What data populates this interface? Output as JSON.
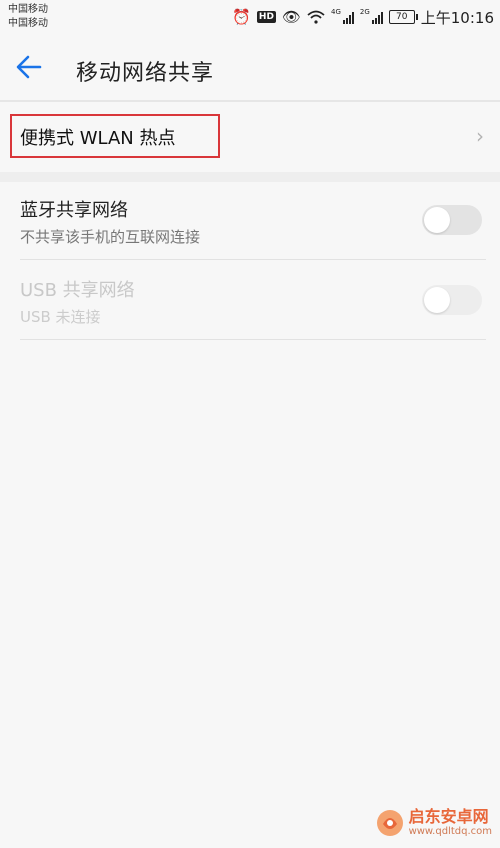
{
  "status_bar": {
    "carrier_1": "中国移动",
    "carrier_2": "中国移动",
    "hd_badge": "HD",
    "net_type_1": "4G",
    "net_type_2": "2G",
    "battery_level": "70",
    "time": "上午10:16",
    "icons": [
      "alarm-icon",
      "hd-icon",
      "eye-icon",
      "wifi-icon",
      "signal-icon",
      "signal-icon",
      "battery-icon"
    ]
  },
  "header": {
    "title": "移动网络共享",
    "back_icon": "back-arrow-icon"
  },
  "hotspot": {
    "label": "便携式 WLAN 热点",
    "chevron": "›",
    "highlight_color": "#d9363a"
  },
  "bluetooth": {
    "title": "蓝牙共享网络",
    "subtitle": "不共享该手机的互联网连接",
    "enabled": false
  },
  "usb": {
    "title": "USB 共享网络",
    "subtitle": "USB 未连接",
    "enabled": false,
    "disabled": true
  },
  "watermark": {
    "name": "启东安卓网",
    "url": "www.qdltdq.com"
  },
  "colors": {
    "accent": "#1a73e8",
    "background": "#f7f7f7",
    "watermark": "#e8673a"
  }
}
